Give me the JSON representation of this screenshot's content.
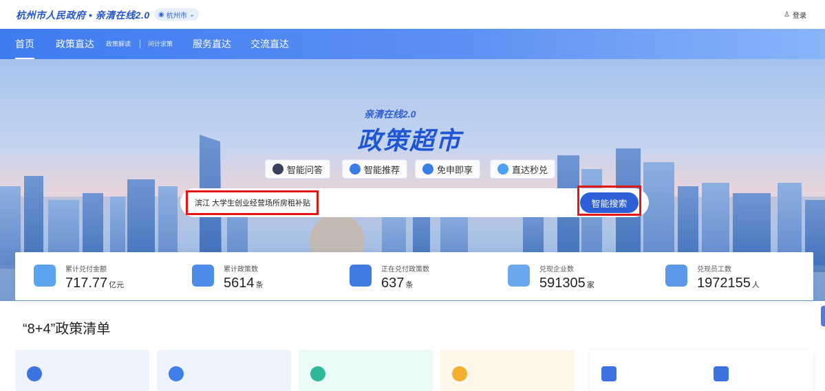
{
  "header": {
    "brand": "杭州市人民政府 • 亲清在线2.0",
    "city": "杭州市",
    "login": "登录"
  },
  "nav": {
    "items": [
      "首页",
      "政策直达",
      "政策解读",
      "问计求策",
      "服务直达",
      "交流直达"
    ]
  },
  "hero": {
    "subtitle": "亲清在线2.0",
    "title": "政策超市",
    "features": [
      "智能问答",
      "智能推荐",
      "免申即享",
      "直达秒兑"
    ],
    "search_value": "滨江 大学生创业经营场所房租补贴",
    "search_button": "智能搜索"
  },
  "stats": [
    {
      "label": "累计兑付金额",
      "value": "717.77",
      "unit": "亿元",
      "icon": "money-report-icon"
    },
    {
      "label": "累计政策数",
      "value": "5614",
      "unit": "条",
      "icon": "policy-doc-icon"
    },
    {
      "label": "正在兑付政策数",
      "value": "637",
      "unit": "条",
      "icon": "payout-doc-icon"
    },
    {
      "label": "兑现企业数",
      "value": "591305",
      "unit": "家",
      "icon": "enterprise-list-icon"
    },
    {
      "label": "兑现员工数",
      "value": "1972155",
      "unit": "人",
      "icon": "employee-card-icon"
    }
  ],
  "section": {
    "title": "“8+4”政策清单"
  },
  "colors": {
    "primary": "#2c5fd8",
    "highlight_border": "#e41515",
    "nav_gradient_start": "#3f7cf0"
  }
}
